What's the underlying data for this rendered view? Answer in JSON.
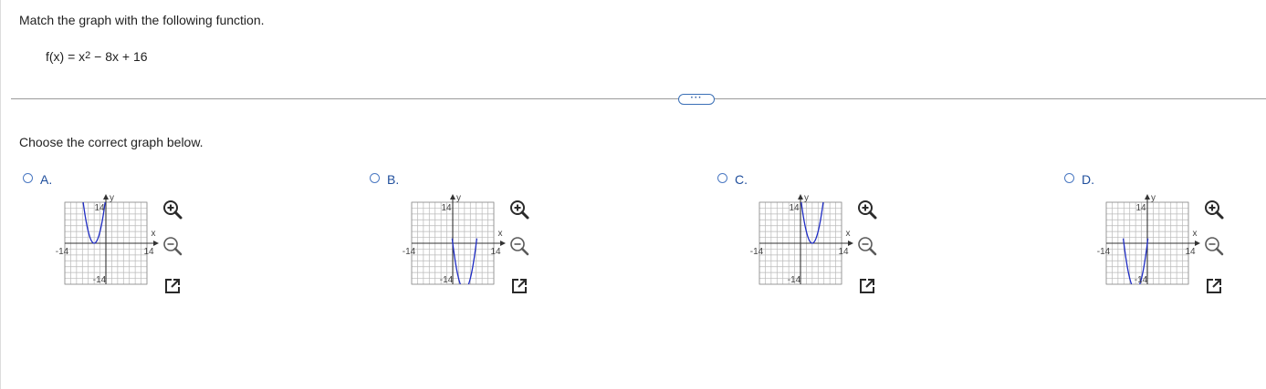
{
  "question": "Match the graph with the following function.",
  "function": {
    "prefix": "f(x) = x",
    "exponent": "2",
    "suffix": " − 8x + 16"
  },
  "more_button": "···",
  "prompt": "Choose the correct graph below.",
  "options": [
    {
      "label": "A.",
      "vertex": [
        -4,
        0
      ]
    },
    {
      "label": "B.",
      "vertex": [
        4,
        -16
      ]
    },
    {
      "label": "C.",
      "vertex": [
        4,
        0
      ]
    },
    {
      "label": "D.",
      "vertex": [
        -4,
        -16
      ]
    }
  ],
  "graph": {
    "x_label": "x",
    "y_label": "y",
    "x_min_label": "-14",
    "x_max_label": "14",
    "y_min_label": "-14",
    "y_max_label": "14",
    "range": [
      -14,
      14
    ],
    "axis_color": "#333333",
    "grid_color": "#b9b9b9",
    "curve_color": "#1f2cc4"
  },
  "tools": [
    "zoom-in-icon",
    "zoom-out-icon",
    "open-new-window-icon"
  ]
}
